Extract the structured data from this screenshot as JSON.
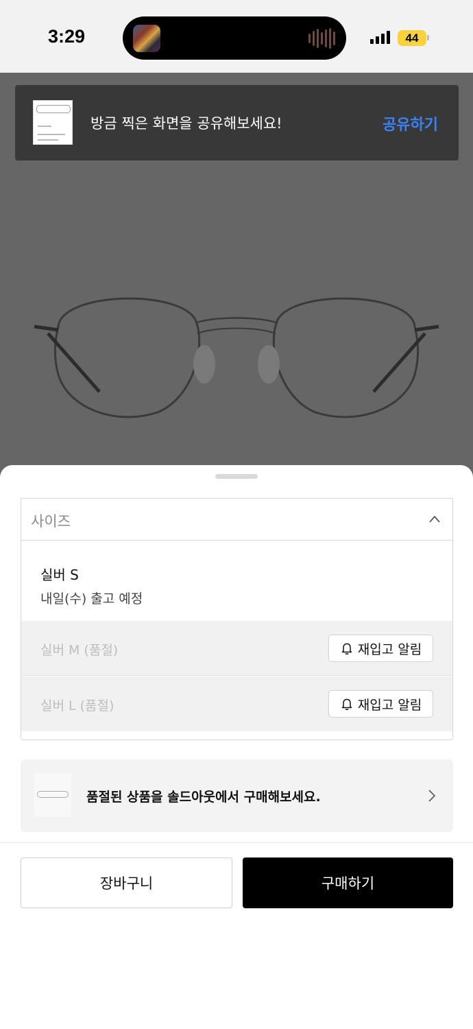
{
  "status_bar": {
    "time": "3:29",
    "battery": "44"
  },
  "toast": {
    "message": "방금 찍은 화면을 공유해보세요!",
    "action_label": "공유하기",
    "action_color": "#3b82f6"
  },
  "size_select": {
    "label": "사이즈",
    "options": [
      {
        "name": "실버 S",
        "status": "내일(수) 출고 예정"
      },
      {
        "name": "실버 M (품절)",
        "restock_label": "재입고 알림"
      },
      {
        "name": "실버 L (품절)",
        "restock_label": "재입고 알림"
      }
    ]
  },
  "soldout_banner": {
    "text": "품절된 상품을 솔드아웃에서 구매해보세요."
  },
  "actions": {
    "cart_label": "장바구니",
    "buy_label": "구매하기"
  }
}
